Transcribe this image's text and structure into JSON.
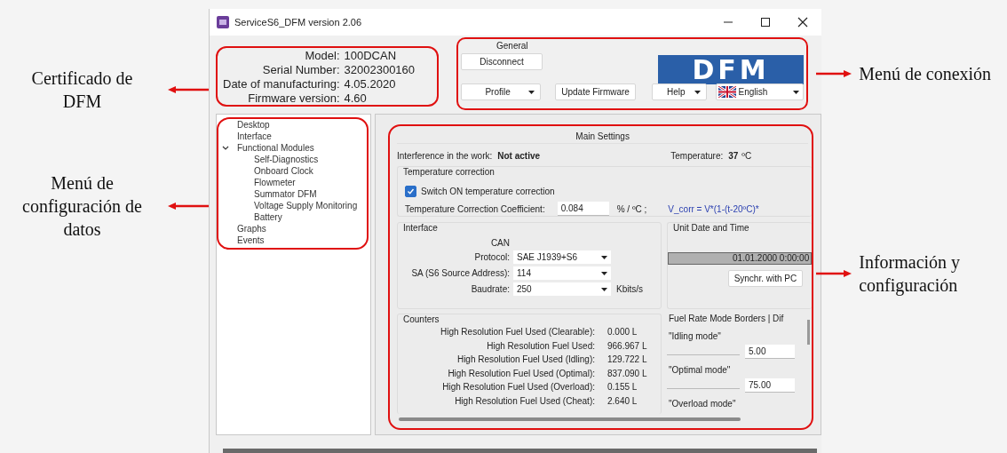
{
  "annotations_left": [
    {
      "text": "Certificado de DFM"
    },
    {
      "text": "Menú de configuración de datos"
    }
  ],
  "annotations_right": [
    {
      "text": "Menú de conexión"
    },
    {
      "text": "Información y configuración"
    }
  ],
  "window": {
    "title": "ServiceS6_DFM version 2.06"
  },
  "certificate": [
    {
      "label": "Model:",
      "value": "100DCAN"
    },
    {
      "label": "Serial Number:",
      "value": "32002300160"
    },
    {
      "label": "Date of manufacturing:",
      "value": "4.05.2020"
    },
    {
      "label": "Firmware version:",
      "value": "4.60"
    }
  ],
  "general": {
    "title": "General",
    "disconnect": "Disconnect",
    "logo": "DFM",
    "profile": "Profile",
    "update_firmware": "Update Firmware",
    "help": "Help",
    "language": "English"
  },
  "tree": [
    {
      "label": "Desktop"
    },
    {
      "label": "Interface"
    },
    {
      "label": "Functional Modules",
      "expanded": true,
      "children": [
        {
          "label": "Self-Diagnostics"
        },
        {
          "label": "Onboard Clock"
        },
        {
          "label": "Flowmeter"
        },
        {
          "label": "Summator DFM"
        },
        {
          "label": "Voltage Supply Monitoring"
        },
        {
          "label": "Battery"
        }
      ]
    },
    {
      "label": "Graphs"
    },
    {
      "label": "Events"
    }
  ],
  "main_settings": {
    "title": "Main Settings",
    "interference_label": "Interference in the work:",
    "interference_value": "Not active",
    "temperature_label": "Temperature:",
    "temperature_value": "37",
    "temperature_unit": "ºC",
    "temperature_correction": {
      "title": "Temperature correction",
      "checkbox": {
        "label": "Switch ON temperature correction",
        "checked": true
      },
      "coefficient_label": "Temperature Correction Coefficient:",
      "coefficient_value": "0.084",
      "coefficient_unit": "% / ºC ;",
      "formula": "V_corr = V*(1-(t-20ºC)*"
    },
    "interface": {
      "title": "Interface",
      "bus": "CAN",
      "rows": [
        {
          "label": "Protocol:",
          "value": "SAE J1939+S6"
        },
        {
          "label": "SA (S6 Source Address):",
          "value": "114"
        },
        {
          "label": "Baudrate:",
          "value": "250",
          "unit": "Kbits/s"
        }
      ]
    },
    "date_time": {
      "title": "Unit Date and Time",
      "value": "01.01.2000 0:00:00",
      "button": "Synchr. with PC"
    },
    "counters": {
      "title": "Counters",
      "rows": [
        {
          "label": "High Resolution Fuel Used  (Clearable):",
          "value": "0.000 L"
        },
        {
          "label": "High Resolution Fuel Used:",
          "value": "966.967 L"
        },
        {
          "label": "High Resolution Fuel Used (Idling):",
          "value": "129.722 L"
        },
        {
          "label": "High Resolution Fuel Used (Optimal):",
          "value": "837.090 L"
        },
        {
          "label": "High Resolution Fuel Used (Overload):",
          "value": "0.155 L"
        },
        {
          "label": "High Resolution Fuel Used (Cheat):",
          "value": "2.640 L"
        }
      ]
    },
    "fuel_rate": {
      "title": "Fuel Rate Mode Borders | Dif",
      "modes": [
        {
          "label": "\"Idling mode\"",
          "value": "5.00"
        },
        {
          "label": "\"Optimal mode\"",
          "value": "75.00"
        },
        {
          "label": "\"Overload mode\""
        }
      ]
    }
  }
}
